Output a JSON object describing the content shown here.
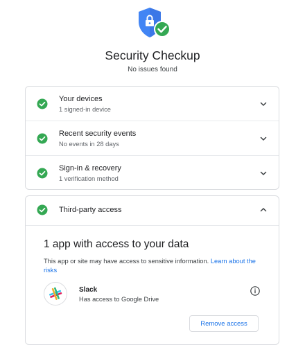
{
  "header": {
    "title": "Security Checkup",
    "subtitle": "No issues found"
  },
  "sections": [
    {
      "title": "Your devices",
      "subtitle": "1 signed-in device",
      "status": "ok"
    },
    {
      "title": "Recent security events",
      "subtitle": "No events in 28 days",
      "status": "ok"
    },
    {
      "title": "Sign-in & recovery",
      "subtitle": "1 verification method",
      "status": "ok"
    }
  ],
  "third_party": {
    "title": "Third-party access",
    "status": "ok",
    "expanded": true,
    "heading": "1 app with access to your data",
    "description": "This app or site may have access to sensitive information.",
    "learn_link": "Learn about the risks",
    "app": {
      "name": "Slack",
      "access": "Has access to Google Drive",
      "icon": "slack-logo-icon"
    },
    "remove_label": "Remove access"
  },
  "colors": {
    "accent_blue": "#1a73e8",
    "shield_blue": "#4285f4",
    "success_green": "#34a853"
  }
}
